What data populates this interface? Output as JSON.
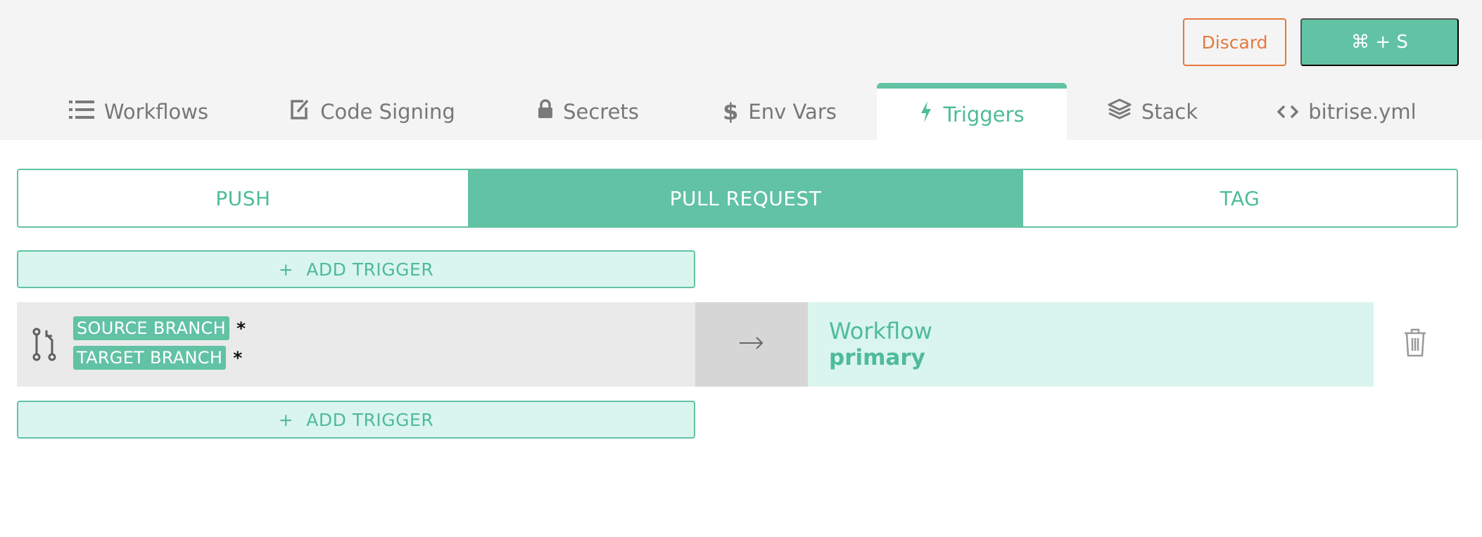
{
  "header": {
    "discard_label": "Discard",
    "save_label": "⌘ + S"
  },
  "tabs": [
    {
      "label": "Workflows",
      "icon": "list-icon"
    },
    {
      "label": "Code Signing",
      "icon": "edit-document-icon"
    },
    {
      "label": "Secrets",
      "icon": "lock-icon"
    },
    {
      "label": "Env Vars",
      "icon": "dollar-icon"
    },
    {
      "label": "Triggers",
      "icon": "lightning-icon",
      "active": true
    },
    {
      "label": "Stack",
      "icon": "layers-icon"
    },
    {
      "label": "bitrise.yml",
      "icon": "code-icon"
    }
  ],
  "trigger_types": [
    {
      "label": "PUSH"
    },
    {
      "label": "PULL REQUEST",
      "active": true
    },
    {
      "label": "TAG"
    }
  ],
  "add_trigger": {
    "plus": "+",
    "label": "ADD TRIGGER"
  },
  "trigger": {
    "source_label": "SOURCE BRANCH",
    "source_value": "*",
    "target_label": "TARGET BRANCH",
    "target_value": "*",
    "workflow_label": "Workflow",
    "workflow_name": "primary"
  },
  "colors": {
    "accent": "#62c2a4",
    "accent_light": "#daf5ee",
    "discard": "#e57a3c"
  }
}
